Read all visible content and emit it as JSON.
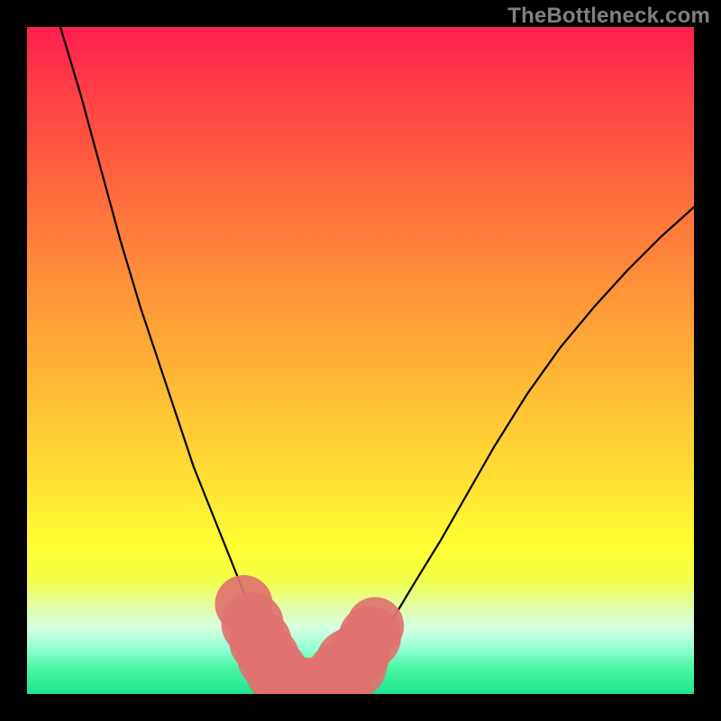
{
  "watermark": "TheBottleneck.com",
  "colors": {
    "background": "#000000",
    "curve": "#000000",
    "point_fill": "#e0736f",
    "gradient_stops": [
      "#ff1f4d",
      "#ff3a47",
      "#ff5740",
      "#ff7a3b",
      "#ff9a38",
      "#ffbd36",
      "#ffe033",
      "#ffff33",
      "#f2ff4a",
      "#e2ffa8",
      "#d8ffe0",
      "#98ffd8",
      "#4cf7a5",
      "#1de490"
    ]
  },
  "chart_data": {
    "type": "line",
    "title": "",
    "xlabel": "",
    "ylabel": "",
    "xlim": [
      0,
      100
    ],
    "ylim": [
      0,
      100
    ],
    "series": [
      {
        "name": "bottleneck_curve",
        "x": [
          5,
          8,
          11,
          14,
          17,
          20,
          23,
          25,
          27,
          29,
          31,
          33,
          34,
          35,
          36,
          37,
          38,
          39,
          40,
          41,
          42,
          43,
          44,
          45,
          46,
          48,
          50,
          52,
          55,
          58,
          62,
          66,
          70,
          75,
          80,
          85,
          90,
          95,
          100
        ],
        "y": [
          100,
          90,
          79,
          68,
          58,
          49,
          40,
          34,
          29,
          24,
          19,
          14,
          11,
          9,
          7,
          5,
          3.5,
          2.5,
          1.8,
          1.2,
          0.8,
          0.5,
          0.4,
          0.5,
          1.0,
          2.2,
          4.2,
          7.0,
          11.5,
          16.5,
          23,
          30,
          37,
          45,
          52,
          58,
          63.5,
          68.5,
          73
        ]
      }
    ],
    "points": [
      {
        "x": 32.5,
        "y": 13.5,
        "r": 1.2
      },
      {
        "x": 33.8,
        "y": 10.5,
        "r": 1.3
      },
      {
        "x": 35.0,
        "y": 7.8,
        "r": 1.3
      },
      {
        "x": 36.2,
        "y": 5.4,
        "r": 1.3
      },
      {
        "x": 37.4,
        "y": 3.4,
        "r": 1.3
      },
      {
        "x": 38.5,
        "y": 1.9,
        "r": 1.3
      },
      {
        "x": 39.6,
        "y": 1.2,
        "r": 1.3
      },
      {
        "x": 40.8,
        "y": 0.9,
        "r": 1.3
      },
      {
        "x": 42.0,
        "y": 0.7,
        "r": 1.3
      },
      {
        "x": 43.2,
        "y": 0.8,
        "r": 1.3
      },
      {
        "x": 44.4,
        "y": 1.1,
        "r": 1.3
      },
      {
        "x": 45.6,
        "y": 1.7,
        "r": 1.3
      },
      {
        "x": 47.0,
        "y": 2.8,
        "r": 1.4
      },
      {
        "x": 48.6,
        "y": 4.5,
        "r": 1.5
      },
      {
        "x": 49.8,
        "y": 6.1,
        "r": 1.3
      },
      {
        "x": 51.4,
        "y": 8.5,
        "r": 1.3
      },
      {
        "x": 52.2,
        "y": 10.2,
        "r": 1.2
      }
    ]
  }
}
